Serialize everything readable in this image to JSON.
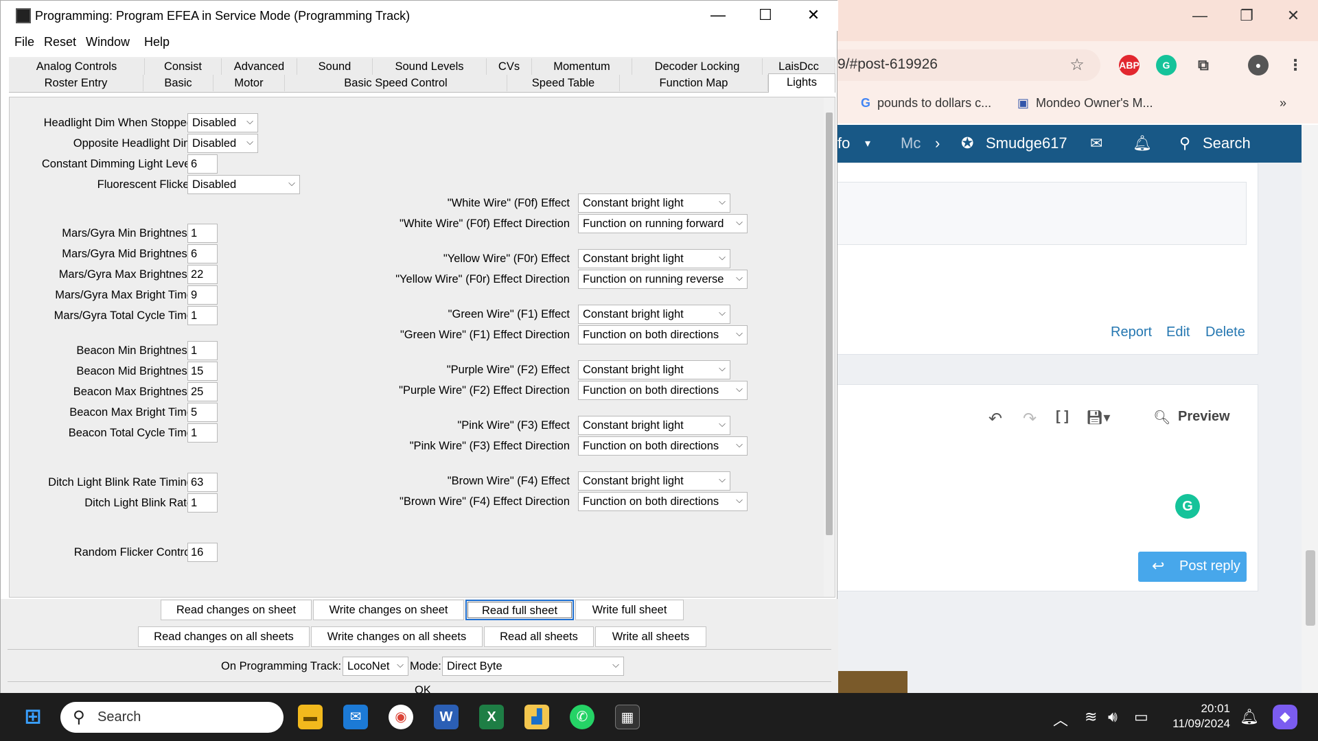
{
  "browser": {
    "address": "9/#post-619926",
    "bookmarks": [
      "pounds to dollars c...",
      "Mondeo Owner's M..."
    ],
    "nav": {
      "item1": "fo",
      "item2": "Mc",
      "user": "Smudge617",
      "search": "Search"
    },
    "actions": [
      "Report",
      "Edit",
      "Delete"
    ],
    "preview": "Preview",
    "post_reply": "Post reply"
  },
  "app": {
    "title": "Programming: Program EFEA in Service Mode (Programming Track)",
    "menu": [
      "File",
      "Reset",
      "Window",
      "Help"
    ],
    "tabs_row1": [
      "Analog Controls",
      "Consist",
      "Advanced",
      "Sound",
      "Sound Levels",
      "CVs",
      "Momentum",
      "Decoder Locking",
      "LaisDcc"
    ],
    "tabs_row2": [
      "Roster Entry",
      "Basic",
      "Motor",
      "Basic Speed Control",
      "Speed Table",
      "Function Map",
      "Lights"
    ],
    "left_settings": [
      {
        "label": "Headlight Dim When Stopped",
        "value": "Disabled"
      },
      {
        "label": "Opposite Headlight Dim",
        "value": "Disabled"
      },
      {
        "label": "Constant Dimming Light Level",
        "value": "6"
      },
      {
        "label": "Fluorescent Flicker",
        "value": "Disabled"
      },
      {
        "label": "Mars/Gyra Min Brightness",
        "value": "1"
      },
      {
        "label": "Mars/Gyra Mid Brightness",
        "value": "6"
      },
      {
        "label": "Mars/Gyra Max Brightness",
        "value": "22"
      },
      {
        "label": "Mars/Gyra Max Bright Time",
        "value": "9"
      },
      {
        "label": "Mars/Gyra Total Cycle Time",
        "value": "1"
      },
      {
        "label": "Beacon Min Brightness",
        "value": "1"
      },
      {
        "label": "Beacon Mid Brightness",
        "value": "15"
      },
      {
        "label": "Beacon Max Brightness",
        "value": "25"
      },
      {
        "label": "Beacon Max Bright Time",
        "value": "5"
      },
      {
        "label": "Beacon Total Cycle Time",
        "value": "1"
      },
      {
        "label": "Ditch Light Blink Rate Timing",
        "value": "63"
      },
      {
        "label": "Ditch Light Blink Rate",
        "value": "1"
      },
      {
        "label": "Random Flicker Control",
        "value": "16"
      }
    ],
    "wire_settings": [
      {
        "label": "\"White Wire\" (F0f) Effect",
        "value": "Constant bright light"
      },
      {
        "label": "\"White Wire\" (F0f) Effect Direction",
        "value": "Function on running forward"
      },
      {
        "label": "\"Yellow Wire\" (F0r) Effect",
        "value": "Constant bright light"
      },
      {
        "label": "\"Yellow Wire\" (F0r) Effect Direction",
        "value": "Function on running reverse"
      },
      {
        "label": "\"Green Wire\" (F1) Effect",
        "value": "Constant bright light"
      },
      {
        "label": "\"Green Wire\" (F1) Effect Direction",
        "value": "Function on both directions"
      },
      {
        "label": "\"Purple Wire\" (F2) Effect",
        "value": "Constant bright light"
      },
      {
        "label": "\"Purple Wire\" (F2) Effect Direction",
        "value": "Function on both directions"
      },
      {
        "label": "\"Pink Wire\" (F3) Effect",
        "value": "Constant bright light"
      },
      {
        "label": "\"Pink Wire\" (F3) Effect Direction",
        "value": "Function on both directions"
      },
      {
        "label": "\"Brown Wire\" (F4) Effect",
        "value": "Constant bright light"
      },
      {
        "label": "\"Brown Wire\" (F4) Effect Direction",
        "value": "Function on both directions"
      }
    ],
    "buttons_row1": [
      "Read changes on sheet",
      "Write changes on sheet",
      "Read full sheet",
      "Write full sheet"
    ],
    "buttons_row2": [
      "Read changes on all sheets",
      "Write changes on all sheets",
      "Read all sheets",
      "Write all sheets"
    ],
    "track_label": "On Programming Track:",
    "track_value": "LocoNet",
    "mode_label": "Mode:",
    "mode_value": "Direct Byte",
    "ok_label": "OK"
  },
  "taskbar": {
    "search": "Search",
    "time": "20:01",
    "date": "11/09/2024"
  },
  "colors": {
    "nav_bg": "#185886",
    "post_reply": "#47a7eb",
    "taskbar": "#1d1d1d",
    "focus": "#1e6fd0"
  }
}
